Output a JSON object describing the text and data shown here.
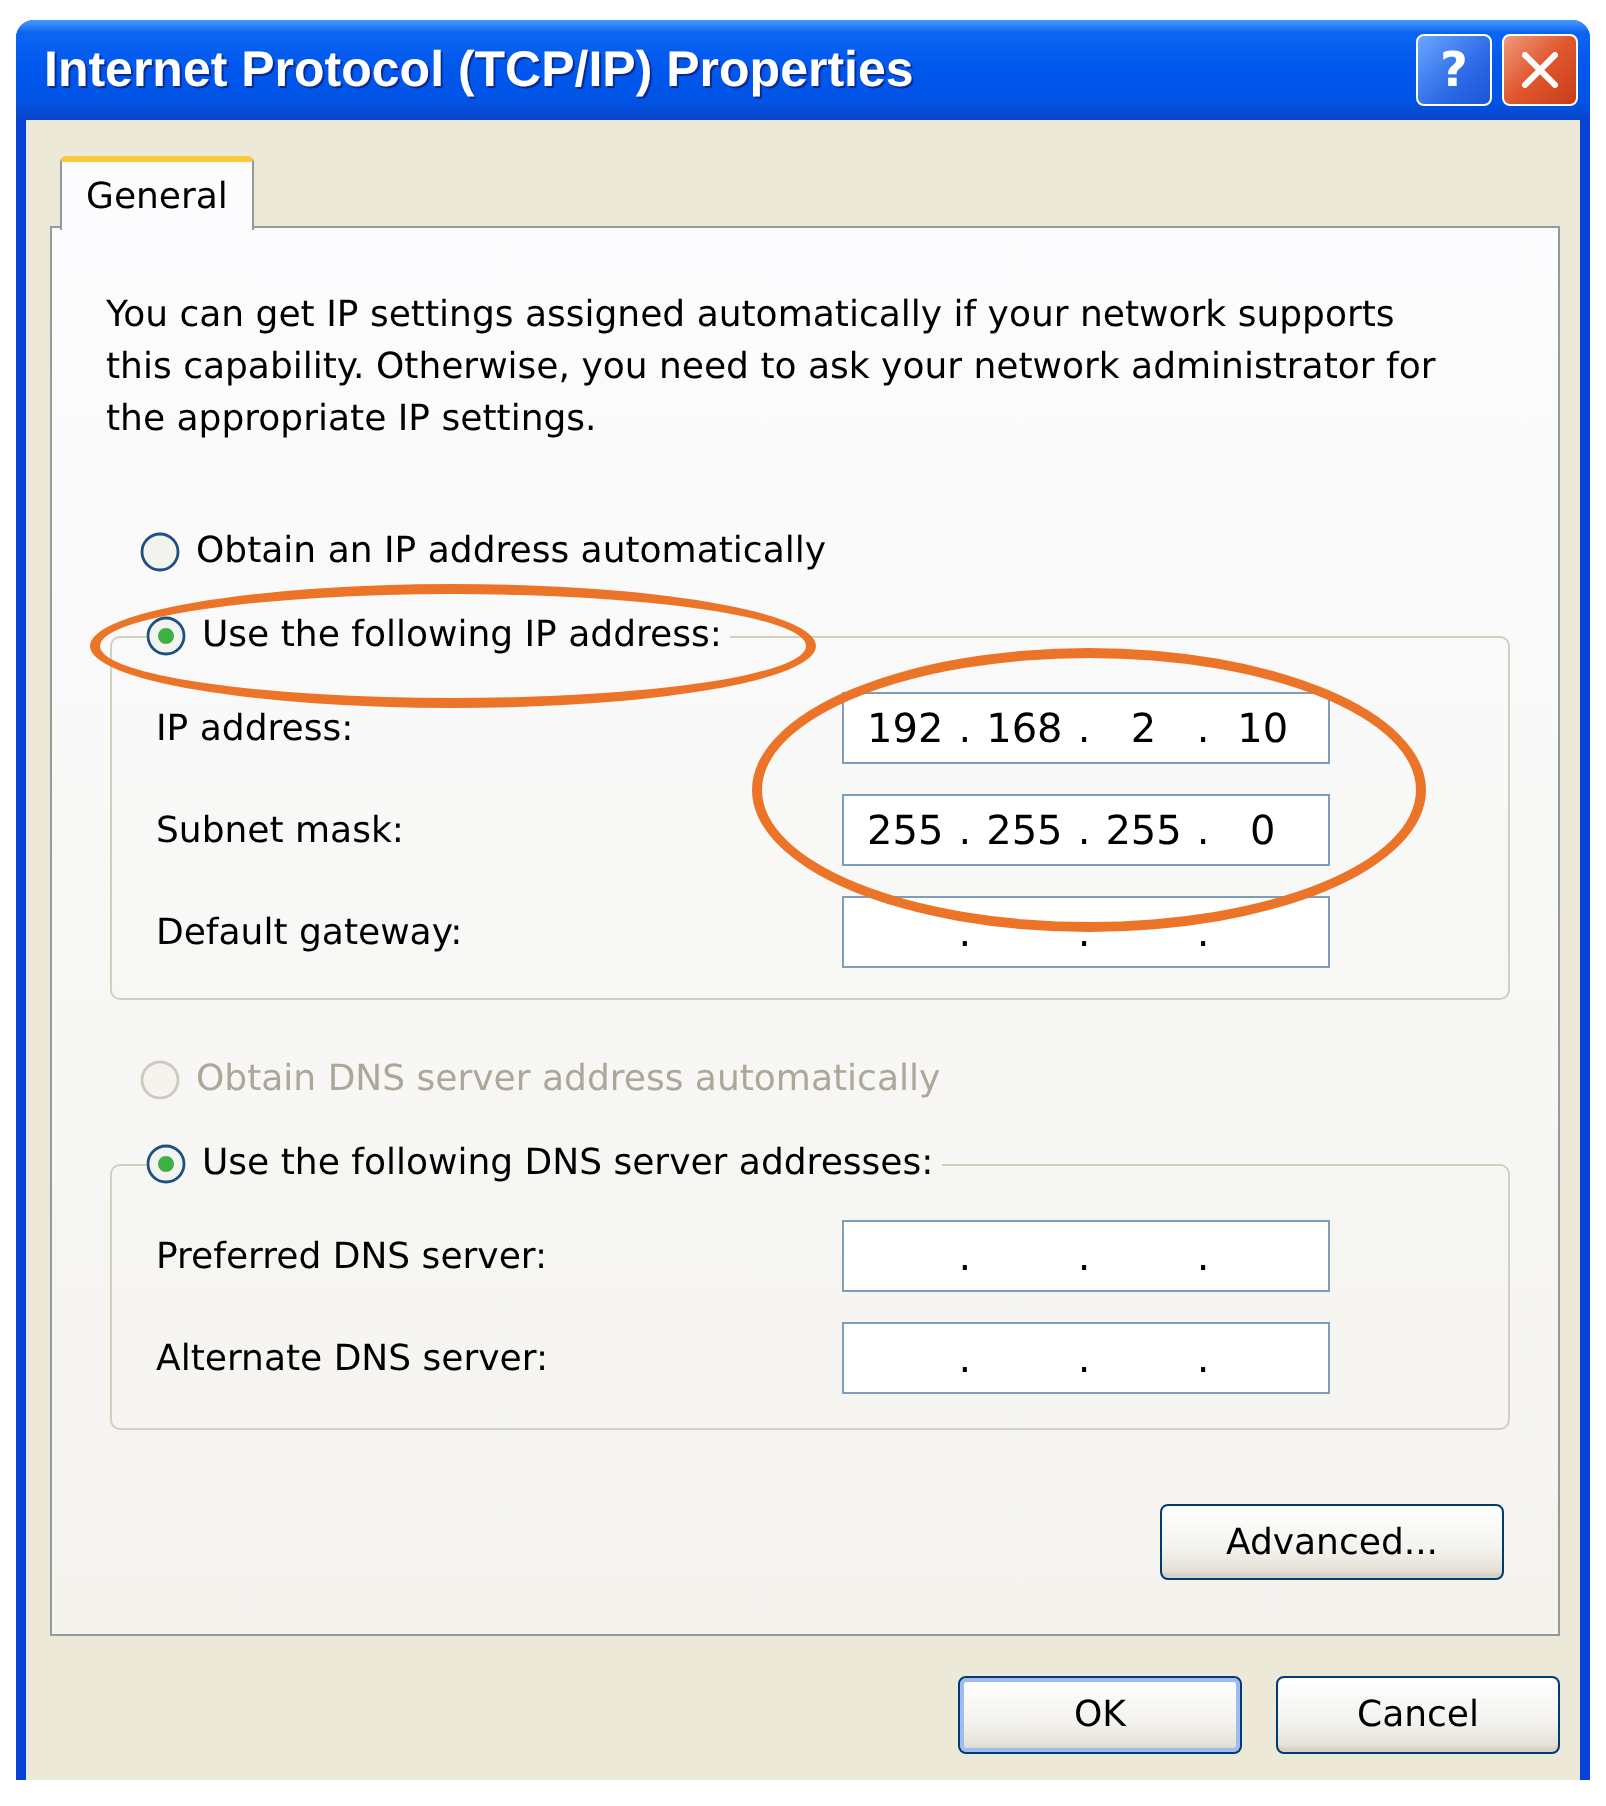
{
  "window": {
    "title": "Internet Protocol (TCP/IP) Properties",
    "buttons": [
      {
        "kind": "help",
        "glyph": "?"
      },
      {
        "kind": "close"
      }
    ]
  },
  "tabs": [
    {
      "label": "General",
      "selected": true
    }
  ],
  "description": "You can get IP settings assigned automatically if your network supports this capability. Otherwise, you need to ask your network administrator for the appropriate IP settings.",
  "ip_mode": {
    "options": [
      {
        "label": "Obtain an IP address automatically",
        "selected": false,
        "disabled": false,
        "circled": false
      },
      {
        "label": "Use the following IP address:",
        "selected": true,
        "disabled": false,
        "circled": true
      }
    ]
  },
  "ip_fields": [
    {
      "label": "IP address:",
      "octets": [
        "192",
        "168",
        "2",
        "10"
      ],
      "separators": [
        ".",
        ".",
        "."
      ],
      "circled": true
    },
    {
      "label": "Subnet mask:",
      "octets": [
        "255",
        "255",
        "255",
        "0"
      ],
      "separators": [
        ".",
        ".",
        "."
      ],
      "circled": true
    },
    {
      "label": "Default gateway:",
      "separators": [
        ".",
        ".",
        "."
      ],
      "circled": false
    }
  ],
  "dns_mode": {
    "options": [
      {
        "label": "Obtain DNS server address automatically",
        "selected": false,
        "disabled": true
      },
      {
        "label": "Use the following DNS server addresses:",
        "selected": true,
        "disabled": false
      }
    ]
  },
  "dns_fields": [
    {
      "label": "Preferred DNS server:",
      "separators": [
        ".",
        ".",
        "."
      ]
    },
    {
      "label": "Alternate DNS server:",
      "separators": [
        ".",
        ".",
        "."
      ]
    }
  ],
  "advanced_button": {
    "label": "Advanced..."
  },
  "buttons": [
    {
      "label": "OK",
      "default": true
    },
    {
      "label": "Cancel",
      "default": false
    }
  ]
}
